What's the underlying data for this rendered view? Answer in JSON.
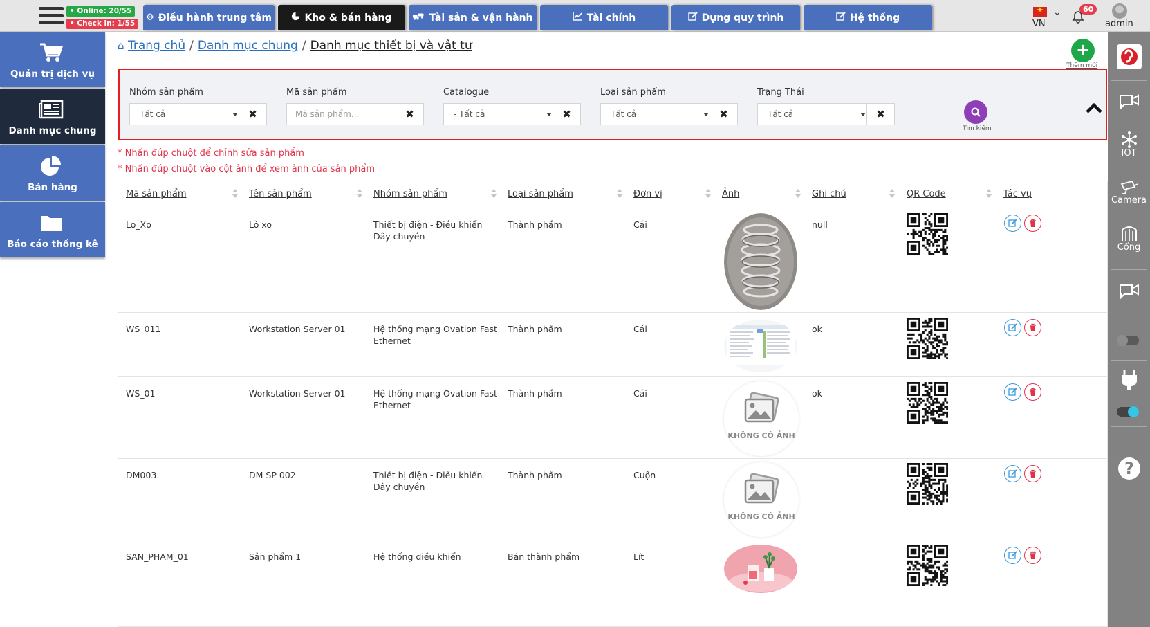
{
  "header": {
    "online_badge": "Online: 20/55",
    "checkin_badge": "Check in: 1/55",
    "tabs": [
      {
        "label": "Điều hành trung tâm",
        "icon": "gear-icon"
      },
      {
        "label": "Kho & bán hàng",
        "icon": "pie-icon"
      },
      {
        "label": "Tài sản & vận hành",
        "icon": "cars-icon"
      },
      {
        "label": "Tài chính",
        "icon": "line-chart-icon"
      },
      {
        "label": "Dựng quy trình",
        "icon": "edit-icon"
      },
      {
        "label": "Hệ thống",
        "icon": "edit-icon"
      }
    ],
    "active_tab": "Kho & bán hàng",
    "language": "VN",
    "notification_count": "60",
    "user": "admin"
  },
  "sidebar": {
    "items": [
      {
        "label": "Quản trị dịch vụ",
        "icon": "cart-icon"
      },
      {
        "label": "Danh mục chung",
        "icon": "newspaper-icon"
      },
      {
        "label": "Bán hàng",
        "icon": "pie-chart-icon"
      },
      {
        "label": "Báo cáo thống kê",
        "icon": "folder-icon"
      }
    ],
    "active": "Danh mục chung"
  },
  "right_rail": {
    "items": [
      {
        "label": "",
        "icon": "brand-logo-icon"
      },
      {
        "label": "",
        "icon": "video-chat-icon"
      },
      {
        "label": "IOT",
        "icon": "iot-icon"
      },
      {
        "label": "Camera",
        "icon": "camera-icon"
      },
      {
        "label": "Cổng",
        "icon": "gate-icon"
      },
      {
        "label": "",
        "icon": "video-chat-icon"
      },
      {
        "label": "",
        "icon": "plug-icon"
      },
      {
        "label": "",
        "icon": "help-icon"
      }
    ],
    "toggle_1_on": false,
    "toggle_2_on": true
  },
  "breadcrumb": {
    "home": "Trang chủ",
    "section": "Danh mục chung",
    "current": "Danh mục thiết bị và vật tư"
  },
  "add_button": {
    "label": "Thêm mới"
  },
  "filters": {
    "group": {
      "label": "Nhóm sản phẩm",
      "value": "Tất cả"
    },
    "code": {
      "label": "Mã sản phẩm",
      "placeholder": "Mã sản phẩm..."
    },
    "catalogue": {
      "label": "Catalogue",
      "value": "- Tất cả"
    },
    "type": {
      "label": "Loại sản phẩm",
      "value": "Tất cả"
    },
    "status": {
      "label": "Trạng Thái",
      "value": "Tất cả"
    },
    "search_label": "Tìm kiếm"
  },
  "hints": [
    "* Nhấn đúp chuột để chỉnh sửa sản phẩm",
    "* Nhấn đúp chuột vào cột ảnh để xem ảnh của sản phẩm"
  ],
  "table": {
    "columns": [
      "Mã sản phẩm",
      "Tên sản phẩm",
      "Nhóm sản phẩm",
      "Loại sản phẩm",
      "Đơn vị",
      "Ảnh",
      "Ghi chú",
      "QR Code",
      "Tác vụ"
    ],
    "no_image_text": "KHÔNG CÓ ẢNH",
    "rows": [
      {
        "code": "Lo_Xo",
        "name": "Lò xo",
        "group": "Thiết bị điện - Điều khiển Dây chuyền",
        "type": "Thành phẩm",
        "unit": "Cái",
        "image": "spring-photo",
        "note": "null"
      },
      {
        "code": "WS_011",
        "name": "Workstation Server 01",
        "group": "Hệ thống mạng Ovation Fast Ethernet",
        "type": "Thành phẩm",
        "unit": "Cái",
        "image": "screenshot-photo",
        "note": "ok"
      },
      {
        "code": "WS_01",
        "name": "Workstation Server 01",
        "group": "Hệ thống mạng Ovation Fast Ethernet",
        "type": "Thành phẩm",
        "unit": "Cái",
        "image": "none",
        "note": "ok"
      },
      {
        "code": "DM003",
        "name": "DM SP 002",
        "group": "Thiết bị điện - Điều khiển Dây chuyền",
        "type": "Thành phẩm",
        "unit": "Cuộn",
        "image": "none",
        "note": ""
      },
      {
        "code": "SAN_PHAM_01",
        "name": "Sản phẩm 1",
        "group": "Hệ thống điều khiển",
        "type": "Bán thành phẩm",
        "unit": "Lít",
        "image": "plant-photo",
        "note": ""
      }
    ]
  },
  "colors": {
    "tab_blue": "#4a6fbd",
    "tab_active": "#1a1a1a",
    "sidebar_active": "#1f2b3d",
    "filter_border": "#e32020",
    "hint_red": "#e0344a",
    "add_green": "#1ea64a",
    "search_purple": "#8e3fb7",
    "rail_gray": "#828282"
  }
}
